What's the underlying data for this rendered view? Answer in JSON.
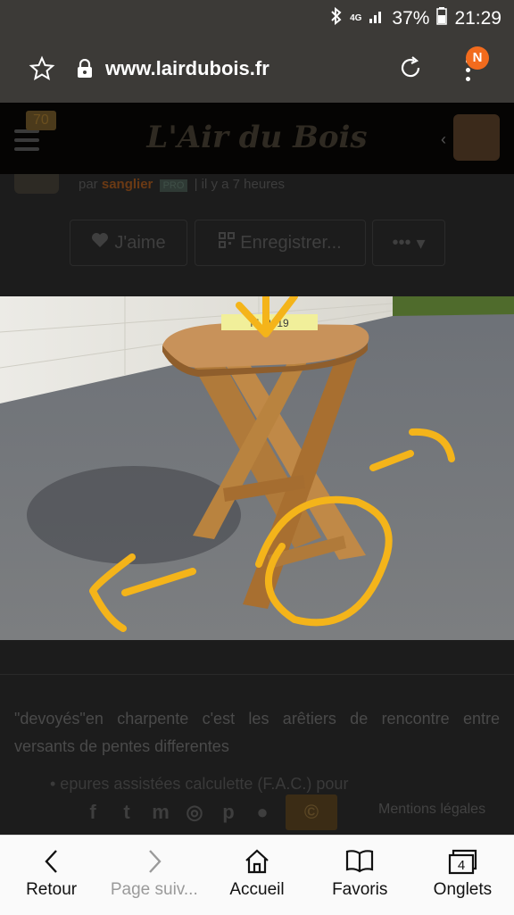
{
  "status": {
    "battery": "37%",
    "time": "21:29",
    "network": "4G"
  },
  "browser": {
    "url": "www.lairdubois.fr",
    "notification_badge": "N"
  },
  "site": {
    "logo": "L'Air du Bois",
    "notification_count": "70",
    "post_by": "par",
    "author": "sanglier",
    "author_badge": "PRO",
    "time_ago": "| il y a 7 heures",
    "actions": {
      "like": "J'aime",
      "save": "Enregistrer...",
      "more": "•••"
    },
    "photo_caption": "M. 2019",
    "paragraph": "\"devoyés\"en charpente c'est les arêtiers de rencontre entre versants de pentes differentes",
    "bullet": "• epures assistées calculette (F.A.C.) pour",
    "footer_link": "Mentions légales"
  },
  "nav": {
    "back": "Retour",
    "forward": "Page suiv...",
    "home": "Accueil",
    "bookmarks": "Favoris",
    "tabs": "Onglets",
    "tabs_count": "4"
  },
  "colors": {
    "accent": "#f26b1d",
    "annotation": "#f4b41a",
    "toolbar": "#3c3a37"
  }
}
